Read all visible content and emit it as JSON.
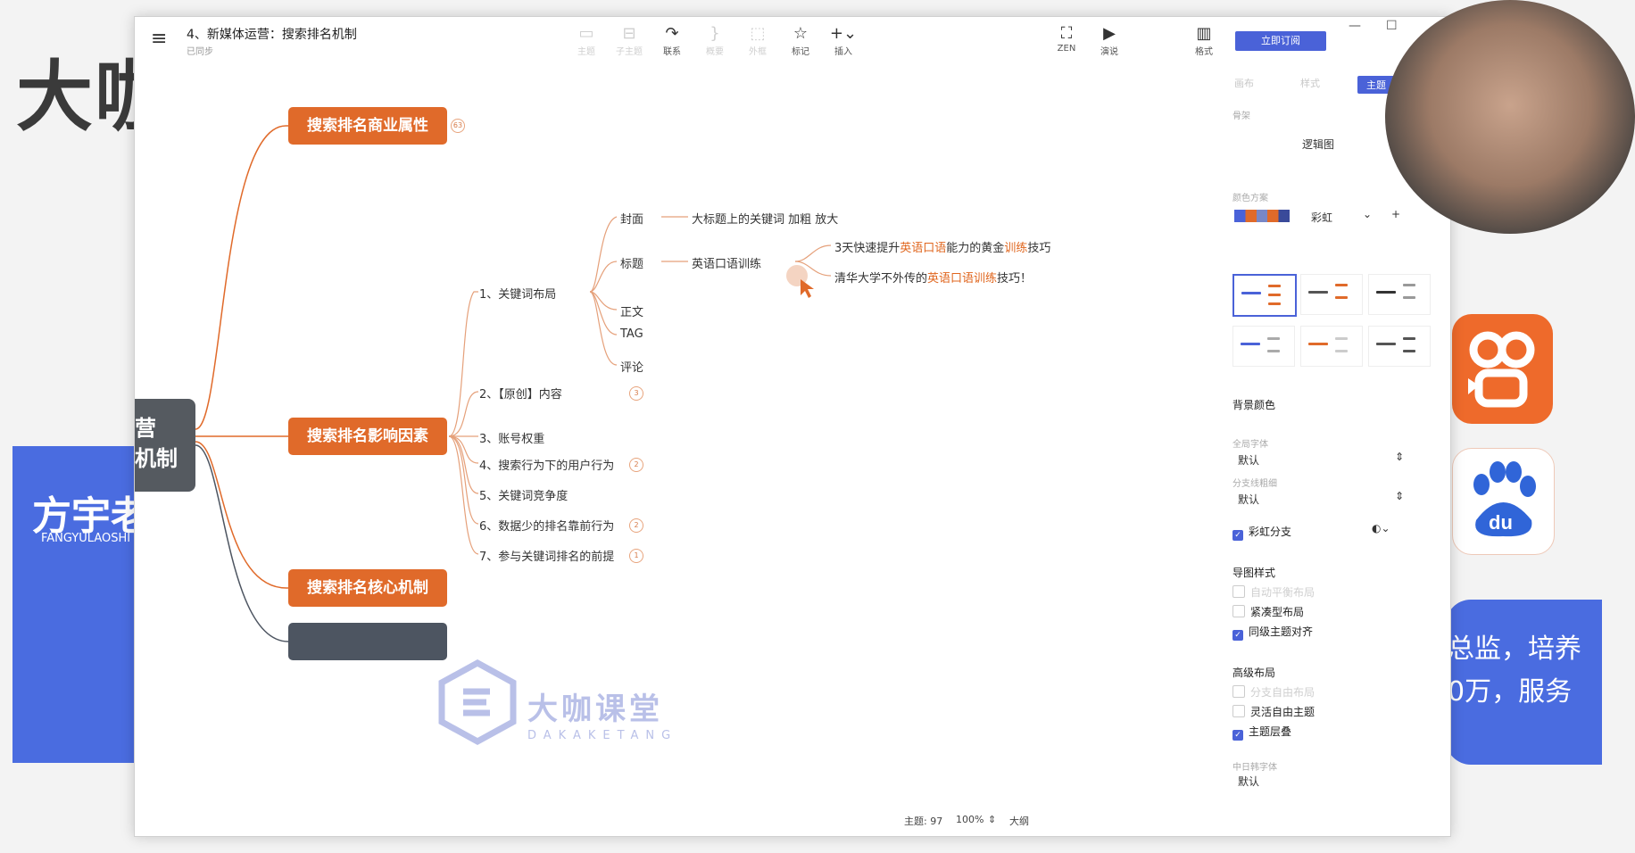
{
  "background": {
    "brand_text": "大咖",
    "card_title": "方宇老",
    "card_sub": "FANGYULAOSHI",
    "right_lines": [
      "总监，培养",
      "0万，服务"
    ]
  },
  "window": {
    "doc_title": "4、新媒体运营：搜索排名机制",
    "doc_sub": "已同步",
    "subscribe_label": "立即订阅",
    "toolbar": [
      {
        "label": "主题",
        "icon": "topic-icon",
        "glyph": "▭",
        "enabled": false
      },
      {
        "label": "子主题",
        "icon": "subtopic-icon",
        "glyph": "⊟",
        "enabled": false
      },
      {
        "label": "联系",
        "icon": "relationship-icon",
        "glyph": "↷",
        "enabled": true
      },
      {
        "label": "概要",
        "icon": "summary-icon",
        "glyph": "}",
        "enabled": false
      },
      {
        "label": "外框",
        "icon": "boundary-icon",
        "glyph": "⬚",
        "enabled": false
      },
      {
        "label": "标记",
        "icon": "star-icon",
        "glyph": "☆",
        "enabled": true
      },
      {
        "label": "插入",
        "icon": "plus-icon",
        "glyph": "+⌄",
        "enabled": true
      }
    ],
    "view_tools": [
      {
        "label": "ZEN",
        "icon": "fullscreen-icon",
        "glyph": "⛶"
      },
      {
        "label": "演说",
        "icon": "present-icon",
        "glyph": "▶"
      }
    ],
    "format_tool": {
      "label": "格式",
      "icon": "format-panel-icon",
      "glyph": "▥"
    }
  },
  "mindmap": {
    "root": [
      "营",
      "机制"
    ],
    "main_topics": [
      {
        "label": "搜索排名商业属性",
        "badge": "63"
      },
      {
        "label": "搜索排名影响因素",
        "badge": ""
      },
      {
        "label": "搜索排名核心机制",
        "badge": ""
      },
      {
        "label": "",
        "badge": ""
      }
    ],
    "factors": [
      {
        "label": "1、关键词布局",
        "badge": ""
      },
      {
        "label": "2、【原创】内容",
        "badge": "3"
      },
      {
        "label": "3、账号权重",
        "badge": ""
      },
      {
        "label": "4、搜索行为下的用户行为",
        "badge": "2"
      },
      {
        "label": "5、关键词竞争度",
        "badge": ""
      },
      {
        "label": "6、数据少的排名靠前行为",
        "badge": "2"
      },
      {
        "label": "7、参与关键词排名的前提",
        "badge": "1"
      }
    ],
    "layout_children": [
      "封面",
      "标题",
      "正文",
      "TAG",
      "评论"
    ],
    "cover_detail": "大标题上的关键词 加粗 放大",
    "title_detail": "英语口语训练",
    "examples": [
      {
        "before": "3天快速提升",
        "hl1": "英语口语",
        "mid": "能力的黄金",
        "hl2": "训练",
        "after": "技巧"
      },
      {
        "before": "清华大学不外传的",
        "hl1": "英语口语训练",
        "mid": "",
        "hl2": "",
        "after": "技巧！"
      }
    ]
  },
  "watermark": {
    "cn": "大咖课堂",
    "en": "DAKAKETANG"
  },
  "status": {
    "topics": "主题: 97",
    "zoom": "100%",
    "outline": "大纲"
  },
  "panel": {
    "tabs": [
      "画布",
      "样式",
      "主题"
    ],
    "structure_label": "骨架",
    "structure_value": "逻辑图",
    "color_scheme_label": "颜色方案",
    "color_scheme_value": "彩虹",
    "bg_color_label": "背景颜色",
    "font_label": "全局字体",
    "font_value": "默认",
    "branch_label": "分支线粗细",
    "branch_value": "默认",
    "rainbow_branch": "彩虹分支",
    "map_style_title": "导图样式",
    "map_style_items": [
      {
        "label": "自动平衡布局",
        "checked": false,
        "enabled": false
      },
      {
        "label": "紧凑型布局",
        "checked": false,
        "enabled": true
      },
      {
        "label": "同级主题对齐",
        "checked": true,
        "enabled": true
      }
    ],
    "advanced_title": "高级布局",
    "advanced_items": [
      {
        "label": "分支自由布局",
        "checked": false,
        "enabled": false
      },
      {
        "label": "灵活自由主题",
        "checked": false,
        "enabled": true
      },
      {
        "label": "主题层叠",
        "checked": true,
        "enabled": true
      }
    ],
    "cjk_font_label": "中日韩字体",
    "cjk_font_value": "默认"
  },
  "colors": {
    "accent": "#4a62d8",
    "topic_orange": "#e06a2a",
    "root": "#555a60"
  }
}
